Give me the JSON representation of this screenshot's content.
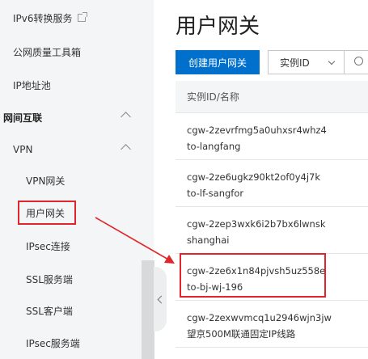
{
  "sidebar": {
    "items": [
      {
        "label": "IPv6转换服务"
      },
      {
        "label": "公网质量工具箱"
      },
      {
        "label": "IP地址池"
      },
      {
        "label": "网间互联"
      },
      {
        "label": "VPN"
      },
      {
        "label": "VPN网关"
      },
      {
        "label": "用户网关"
      },
      {
        "label": "IPsec连接"
      },
      {
        "label": "SSL服务端"
      },
      {
        "label": "SSL客户端"
      },
      {
        "label": "IPsec服务端"
      }
    ]
  },
  "main": {
    "title": "用户网关",
    "create_button": "创建用户网关",
    "filter": {
      "selected": "实例ID"
    },
    "table": {
      "header": "实例ID/名称",
      "rows": [
        {
          "id": "cgw-2zevrfmg5a0uhxsr4whz4",
          "name": "to-langfang"
        },
        {
          "id": "cgw-2ze6ugkz90kt2of0y4j7k",
          "name": "to-lf-sangfor"
        },
        {
          "id": "cgw-2zep3wxk6i2b7bx6lwnsk",
          "name": "shanghai"
        },
        {
          "id": "cgw-2ze6x1n84pjvsh5uz558e",
          "name": "to-bj-wj-196"
        },
        {
          "id": "cgw-2zexwvmcq1u2946wjn3jw",
          "name": "望京500M联通固定IP线路"
        }
      ]
    }
  },
  "annotation": {
    "color": "#e0262b"
  }
}
